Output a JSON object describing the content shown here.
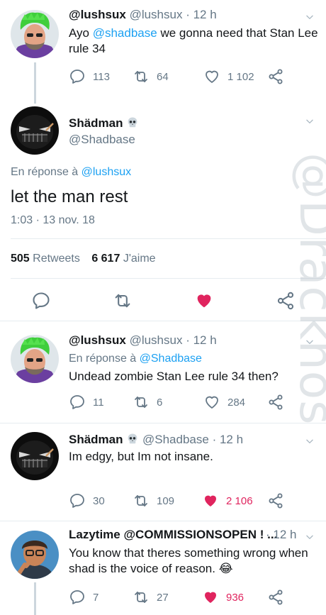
{
  "watermark": "@Drackhos",
  "tweet1": {
    "name": "@lushsux",
    "handle": "@lushsux",
    "time": "· 12 h",
    "text_prefix": "Ayo ",
    "mention": "@shadbase",
    "text_suffix": " we gonna need that Stan Lee",
    "text_line2": "rule 34",
    "replies": "113",
    "retweets": "64",
    "likes": "1 102"
  },
  "main": {
    "name": "Shädman",
    "handle": "@Shadbase",
    "reply_to_label": "En réponse à ",
    "reply_to": "@lushsux",
    "text": "let the man rest",
    "timestamp": "1:03 · 13 nov. 18",
    "retweets_count": "505",
    "retweets_label": "Retweets",
    "likes_count": "6 617",
    "likes_label": "J'aime"
  },
  "reply1": {
    "name": "@lushsux",
    "handle": "@lushsux",
    "time": "· 12 h",
    "reply_to_label": "En réponse à ",
    "reply_to": "@Shadbase",
    "text": "Undead zombie Stan Lee rule 34 then?",
    "replies": "11",
    "retweets": "6",
    "likes": "284"
  },
  "reply2": {
    "name": "Shädman",
    "handle": "@Shadbase",
    "time": "· 12 h",
    "text": "Im edgy, but Im not insane.",
    "replies": "30",
    "retweets": "109",
    "likes": "2 106"
  },
  "reply3": {
    "name": "Lazytime @COMMISSIONSOPEN ! ...",
    "time": "· 12 h",
    "text_line1": "You know that theres something wrong when",
    "text_line2": "shad is the voice of reason.",
    "emoji": "😂",
    "replies": "7",
    "retweets": "27",
    "likes": "936"
  },
  "colors": {
    "accent": "#1da1f2",
    "like": "#e0245e",
    "muted": "#657786"
  }
}
